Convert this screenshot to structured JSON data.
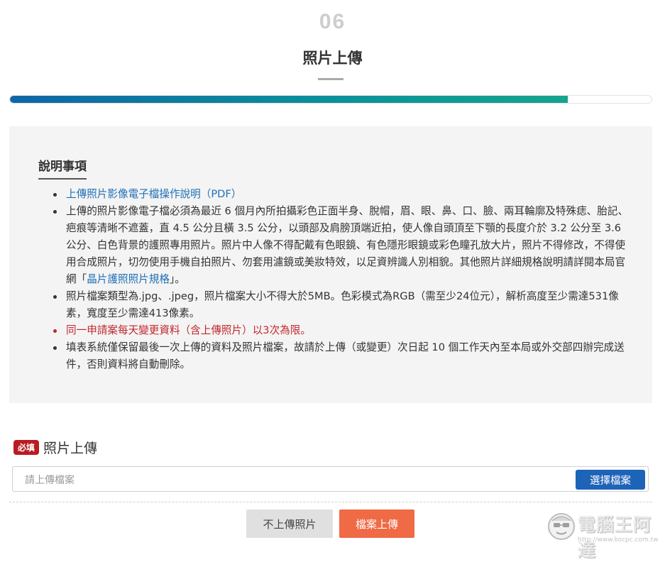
{
  "step": {
    "number": "06",
    "title": "照片上傳",
    "progress_percent": 87
  },
  "notes": {
    "heading": "說明事項",
    "items": [
      {
        "link": "上傳照片影像電子檔操作說明（PDF）"
      },
      {
        "text_before": "上傳的照片影像電子檔必須為最近 6 個月內所拍攝彩色正面半身、脫帽，眉、眼、鼻、口、臉、兩耳輪廓及特殊痣、胎記、疤痕等清晰不遮蓋，直 4.5 公分且橫 3.5 公分，以頭部及肩膀頂端近拍，使人像自頭頂至下顎的長度介於 3.2 公分至 3.6 公分、白色背景的護照專用照片。照片中人像不得配戴有色眼鏡、有色隱形眼鏡或彩色瞳孔放大片，照片不得修改，不得使用合成照片，切勿使用手機自拍照片、勿套用濾鏡或美妝特效，以足資辨識人別相貌。其他照片詳細規格說明請詳閱本局官網「",
        "link": "晶片護照照片規格",
        "text_after": "」。"
      },
      {
        "text": "照片檔案類型為.jpg、.jpeg，照片檔案大小不得大於5MB。色彩模式為RGB（需至少24位元），解析高度至少需達531像素，寬度至少需達413像素。"
      },
      {
        "text": "同一申請案每天變更資料（含上傳照片）以3次為限。"
      },
      {
        "text": "填表系統僅保留最後一次上傳的資料及照片檔案，故請於上傳（或變更）次日起 10 個工作天內至本局或外交部四辦完成送件，否則資料將自動刪除。"
      }
    ]
  },
  "upload": {
    "required_badge": "必填",
    "label": "照片上傳",
    "placeholder": "請上傳檔案",
    "choose_button": "選擇檔案"
  },
  "actions": {
    "skip_button": "不上傳照片",
    "upload_button": "檔案上傳"
  },
  "watermark": {
    "name": "電腦王阿達",
    "url": "http://www.kocpc.com.tw",
    "icon": "mascot-face-icon"
  },
  "colors": {
    "progress_start": "#0f66a6",
    "progress_end": "#15a48c",
    "required_badge": "#b81c22",
    "warning_text": "#c0272d",
    "link": "#1f6fb5",
    "choose_button": "#1d63b8",
    "upload_button": "#ef6a45",
    "skip_button": "#e0e0e0"
  }
}
